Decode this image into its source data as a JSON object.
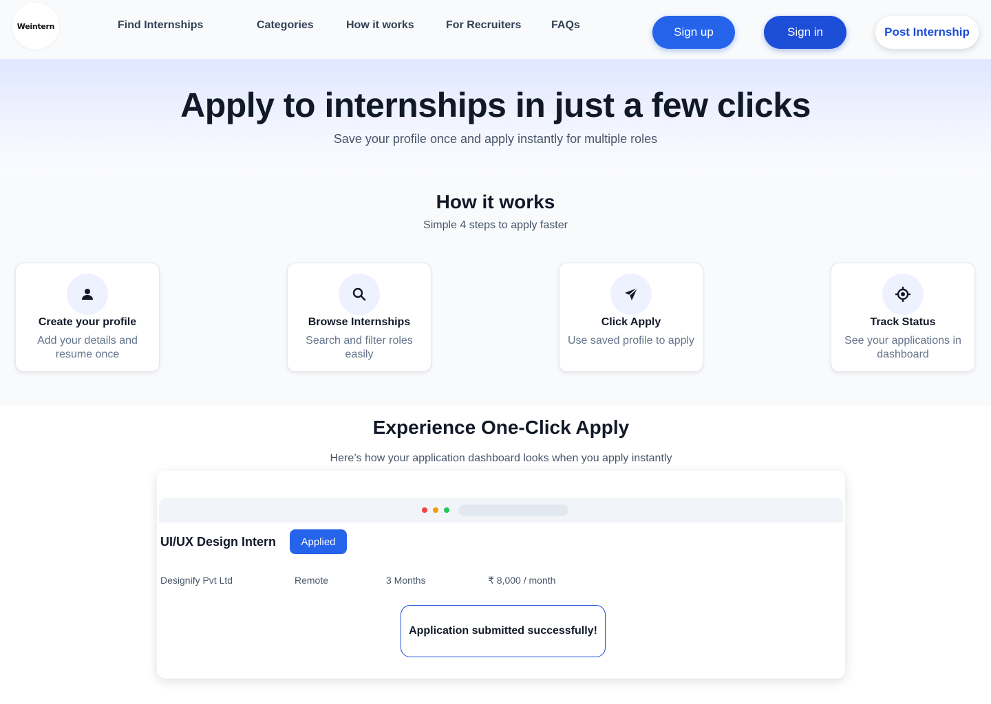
{
  "nav": {
    "logo_text": "Weintern",
    "links": [
      "Find Internships",
      "Categories",
      "How it works",
      "For Recruiters",
      "FAQs"
    ],
    "signup": "Sign up",
    "signin": "Sign in",
    "post": "Post Internship"
  },
  "hero": {
    "title": "Apply to internships in just a few clicks",
    "subtitle": "Save your profile once and apply instantly for multiple roles"
  },
  "how": {
    "title": "How it works",
    "subtitle": "Simple 4 steps to apply faster",
    "steps": [
      {
        "icon": "user-icon",
        "title": "Create your profile",
        "desc": "Add your details and resume once"
      },
      {
        "icon": "search-icon",
        "title": "Browse Internships",
        "desc": "Search and filter roles easily"
      },
      {
        "icon": "send-icon",
        "title": "Click Apply",
        "desc": "Use saved profile to apply"
      },
      {
        "icon": "target-icon",
        "title": "Track Status",
        "desc": "See your applications in dashboard"
      }
    ]
  },
  "experience": {
    "title": "Experience One-Click Apply",
    "subtitle": "Here’s how your application dashboard looks when you apply instantly",
    "job_title": "UI/UX Design Intern",
    "badge": "Applied",
    "company": "Designify Pvt Ltd",
    "location": "Remote",
    "duration": "3 Months",
    "stipend": "₹ 8,000 / month",
    "toast": "Application submitted successfully!"
  },
  "colors": {
    "primary": "#2563eb",
    "primary_dark": "#1d4ed8",
    "window_dot_red": "#ef4444",
    "window_dot_orange": "#f59e0b",
    "window_dot_green": "#22c55e"
  }
}
